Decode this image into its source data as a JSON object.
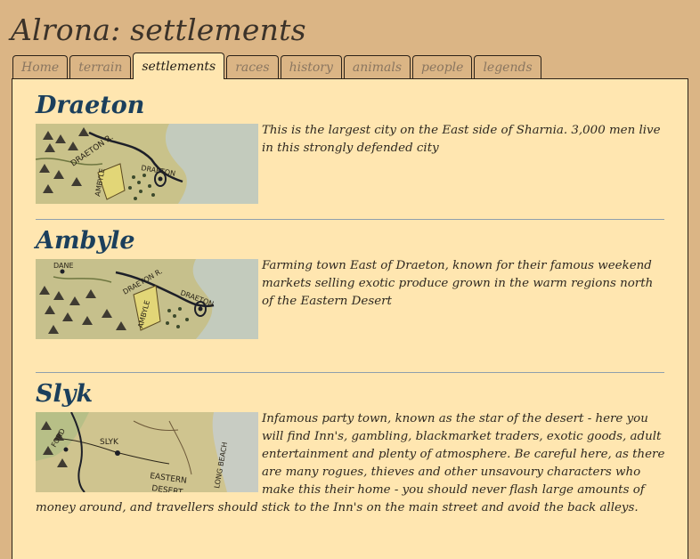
{
  "site": {
    "title": "Alrona: settlements"
  },
  "tabs": [
    {
      "label": "Home",
      "active": false
    },
    {
      "label": "terrain",
      "active": false
    },
    {
      "label": "settlements",
      "active": true
    },
    {
      "label": "races",
      "active": false
    },
    {
      "label": "history",
      "active": false
    },
    {
      "label": "animals",
      "active": false
    },
    {
      "label": "people",
      "active": false
    },
    {
      "label": "legends",
      "active": false
    }
  ],
  "settlements": [
    {
      "name": "Draeton",
      "description": "This is the largest city on the East side of Sharnia. 3,000 men live in this strongly defended city",
      "map_labels": [
        "DRAETON R.",
        "AMBYLE",
        "DRAETON"
      ]
    },
    {
      "name": "Ambyle",
      "description": "Farming town East of Draeton, known for their famous weekend markets selling exotic produce grown in the warm regions north of the Eastern Desert",
      "map_labels": [
        "DANE",
        "DRAETON R.",
        "AMBYLE",
        "DRAETON"
      ]
    },
    {
      "name": "Slyk",
      "description": "Infamous party town, known as the star of the desert - here you will find Inn's, gambling, blackmarket traders, exotic goods, adult entertainment and plenty of atmosphere. Be careful here, as there are many rogues, thieves and other unsavoury characters who make this their home - you should never flash large amounts of money around, and travellers should stick to the Inn's on the main street and avoid the back alleys.",
      "map_labels": [
        "FORD",
        "SLYK",
        "EASTERN",
        "DESERT",
        "LONG BEACH"
      ]
    }
  ],
  "colors": {
    "page_background": "#dbb585",
    "panel_background": "#ffe6b0",
    "heading": "#1b3f5c",
    "divider": "#8fa0ad"
  }
}
